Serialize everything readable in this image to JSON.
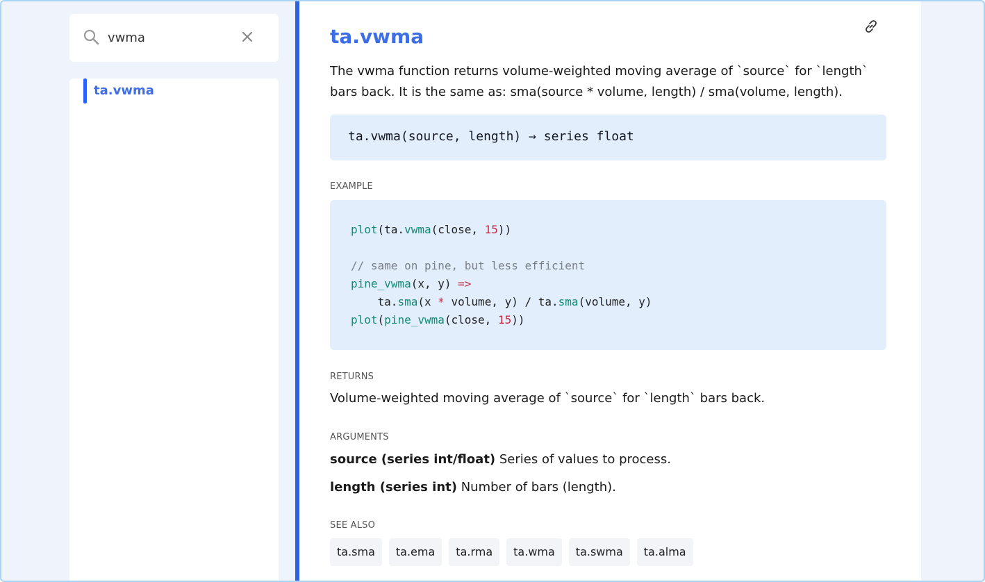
{
  "search": {
    "query": "vwma"
  },
  "results": [
    {
      "label": "ta.vwma"
    }
  ],
  "doc": {
    "title": "ta.vwma",
    "description": "The vwma function returns volume-weighted moving average of `source` for `length` bars back. It is the same as: sma(source * volume, length) / sma(volume, length).",
    "signature": "ta.vwma(source, length) → series float",
    "example_label": "EXAMPLE",
    "code": {
      "line1": {
        "fn": "plot",
        "open": "(ta.",
        "fn2": "vwma",
        "args": "(close, ",
        "num": "15",
        "close": "))"
      },
      "line3": {
        "comment": "// same on pine, but less efficient"
      },
      "line4": {
        "fn": "pine_vwma",
        "args": "(x, y) ",
        "op": "=>"
      },
      "line5": {
        "pre": "    ta.",
        "fn": "sma",
        "mid": "(x ",
        "op1": "*",
        "mid2": " volume, y) ",
        "op2": "/",
        "pre2": " ta.",
        "fn2": "sma",
        "end": "(volume, y)"
      },
      "line6": {
        "fn": "plot",
        "open": "(",
        "fn2": "pine_vwma",
        "args": "(close, ",
        "num": "15",
        "close": "))"
      }
    },
    "returns_label": "RETURNS",
    "returns": "Volume-weighted moving average of `source` for `length` bars back.",
    "arguments_label": "ARGUMENTS",
    "arguments": [
      {
        "name": "source (series int/float)",
        "desc": " Series of values to process."
      },
      {
        "name": "length (series int)",
        "desc": " Number of bars (length)."
      }
    ],
    "see_also_label": "SEE ALSO",
    "see_also": [
      "ta.sma",
      "ta.ema",
      "ta.rma",
      "ta.wma",
      "ta.swma",
      "ta.alma"
    ]
  },
  "colors": {
    "accent": "#2e62e0",
    "title": "#3d6ee6",
    "code_bg": "#e2eefc",
    "fn": "#138a73",
    "number": "#c8283f"
  }
}
